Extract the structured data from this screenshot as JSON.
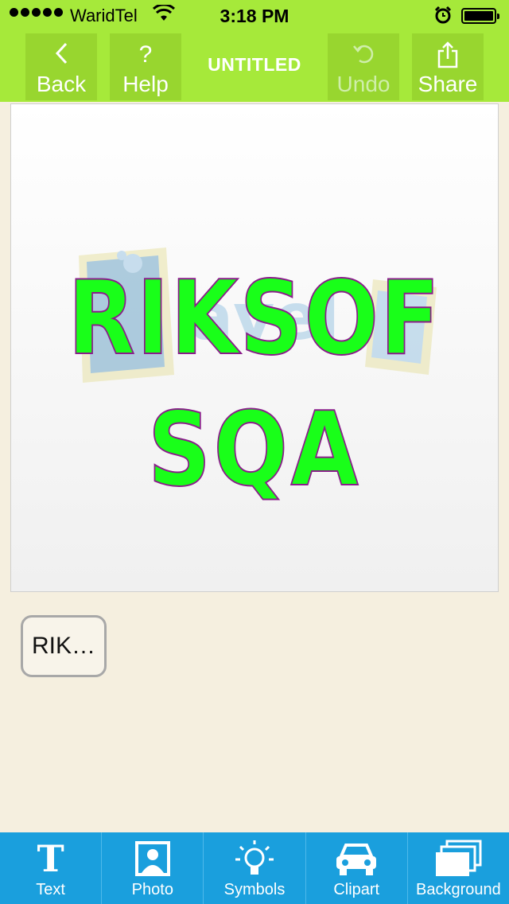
{
  "status_bar": {
    "carrier": "WaridTel",
    "time": "3:18 PM"
  },
  "nav": {
    "back_label": "Back",
    "help_label": "Help",
    "title": "UNTITLED",
    "undo_label": "Undo",
    "share_label": "Share",
    "undo_enabled": false
  },
  "canvas": {
    "line1": "RIKSOF",
    "line2": "SQA",
    "text_fill": "#19ff19",
    "text_stroke": "#8a1c8a"
  },
  "text_chip": {
    "label": "RIK…"
  },
  "toolbar": {
    "items": [
      {
        "label": "Text",
        "icon": "text-icon"
      },
      {
        "label": "Photo",
        "icon": "photo-icon"
      },
      {
        "label": "Symbols",
        "icon": "lightbulb-icon"
      },
      {
        "label": "Clipart",
        "icon": "car-icon"
      },
      {
        "label": "Background",
        "icon": "layers-icon"
      }
    ]
  },
  "colors": {
    "nav_bg": "#a6e93a",
    "toolbar_bg": "#1a9fdd",
    "page_bg": "#f5efdf"
  }
}
